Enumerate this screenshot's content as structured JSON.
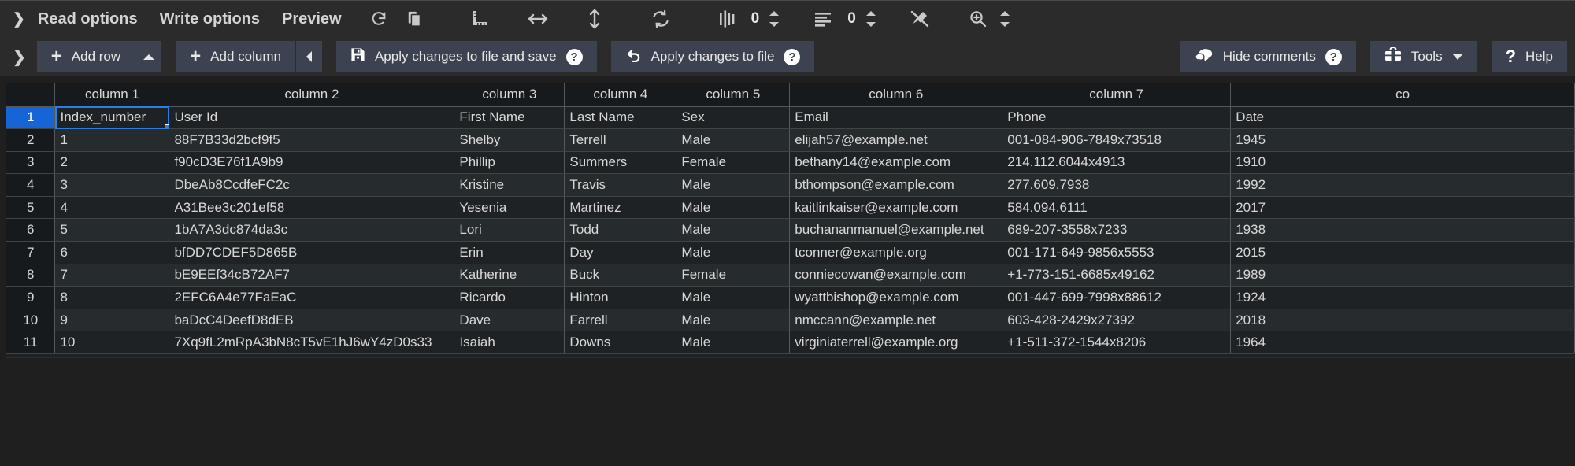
{
  "toolbar_top": {
    "expand_icon": "chevron-right-icon",
    "read_options_label": "Read options",
    "write_options_label": "Write options",
    "preview_label": "Preview",
    "icons": [
      {
        "name": "refresh-icon",
        "title": "Refresh"
      },
      {
        "name": "copy-icon",
        "title": "Copy"
      },
      {
        "name": "ruler-icon",
        "title": "Resize"
      },
      {
        "name": "arrows-horizontal-icon",
        "title": "Fit width"
      },
      {
        "name": "arrows-vertical-icon",
        "title": "Fit height"
      },
      {
        "name": "sync-icon",
        "title": "Sync"
      },
      {
        "name": "columns-icon",
        "title": "Freeze columns"
      },
      {
        "name": "rows-icon",
        "title": "Freeze rows"
      },
      {
        "name": "format-paint-off-icon",
        "title": "Clear formatting"
      },
      {
        "name": "zoom-in-icon",
        "title": "Zoom"
      }
    ],
    "freeze_columns_value": "0",
    "freeze_rows_value": "0",
    "spinner_up_icon": "chevron-up-icon",
    "spinner_down_icon": "chevron-down-icon"
  },
  "toolbar_main": {
    "expand_icon": "chevron-right-icon",
    "add_row_label": "Add row",
    "add_row_icon": "plus-icon",
    "add_row_split_icon": "triangle-up-icon",
    "add_column_label": "Add column",
    "add_column_icon": "plus-icon",
    "add_column_split_icon": "triangle-left-icon",
    "apply_save_label": "Apply changes to file and save",
    "apply_save_icon": "save-icon",
    "apply_save_help_icon": "question-circle-icon",
    "apply_label": "Apply changes to file",
    "apply_icon": "undo-arrow-icon",
    "apply_help_icon": "question-circle-icon",
    "hide_comments_label": "Hide comments",
    "hide_comments_icon": "comment-icon",
    "hide_comments_help_icon": "question-circle-icon",
    "tools_label": "Tools",
    "tools_icon": "toolbox-icon",
    "tools_caret_icon": "caret-down-icon",
    "help_label": "Help",
    "help_icon": "question-mark-icon"
  },
  "grid": {
    "selected_cell": "A1",
    "selected_column_header": "column 1",
    "selected_row_header": "1",
    "accent_color": "#1565d8",
    "selection_border_color": "#2a7fe0",
    "column_headers": [
      "column 1",
      "column 2",
      "column 3",
      "column 4",
      "column 5",
      "column 6",
      "column 7",
      "co"
    ],
    "row_headers": [
      "1",
      "2",
      "3",
      "4",
      "5",
      "6",
      "7",
      "8",
      "9",
      "10",
      "11"
    ],
    "rows": [
      [
        "Index_number",
        "User Id",
        "First Name",
        "Last Name",
        "Sex",
        "Email",
        "Phone",
        "Date"
      ],
      [
        "1",
        "88F7B33d2bcf9f5",
        "Shelby",
        "Terrell",
        "Male",
        "elijah57@example.net",
        "001-084-906-7849x73518",
        "1945"
      ],
      [
        "2",
        "f90cD3E76f1A9b9",
        "Phillip",
        "Summers",
        "Female",
        "bethany14@example.com",
        "214.112.6044x4913",
        "1910"
      ],
      [
        "3",
        "DbeAb8CcdfeFC2c",
        "Kristine",
        "Travis",
        "Male",
        "bthompson@example.com",
        "277.609.7938",
        "1992"
      ],
      [
        "4",
        "A31Bee3c201ef58",
        "Yesenia",
        "Martinez",
        "Male",
        "kaitlinkaiser@example.com",
        "584.094.6111",
        "2017"
      ],
      [
        "5",
        "1bA7A3dc874da3c",
        "Lori",
        "Todd",
        "Male",
        "buchananmanuel@example.net",
        "689-207-3558x7233",
        "1938"
      ],
      [
        "6",
        "bfDD7CDEF5D865B",
        "Erin",
        "Day",
        "Male",
        "tconner@example.org",
        "001-171-649-9856x5553",
        "2015"
      ],
      [
        "7",
        "bE9EEf34cB72AF7",
        "Katherine",
        "Buck",
        "Female",
        "conniecowan@example.com",
        "+1-773-151-6685x49162",
        "1989"
      ],
      [
        "8",
        "2EFC6A4e77FaEaC",
        "Ricardo",
        "Hinton",
        "Male",
        "wyattbishop@example.com",
        "001-447-699-7998x88612",
        "1924"
      ],
      [
        "9",
        "baDcC4DeefD8dEB",
        "Dave",
        "Farrell",
        "Male",
        "nmccann@example.net",
        "603-428-2429x27392",
        "2018"
      ],
      [
        "10",
        "7Xq9fL2mRpA3bN8cT5vE1hJ6wY4zD0s33",
        "Isaiah",
        "Downs",
        "Male",
        "virginiaterrell@example.org",
        "+1-511-372-1544x8206",
        "1964"
      ]
    ]
  }
}
